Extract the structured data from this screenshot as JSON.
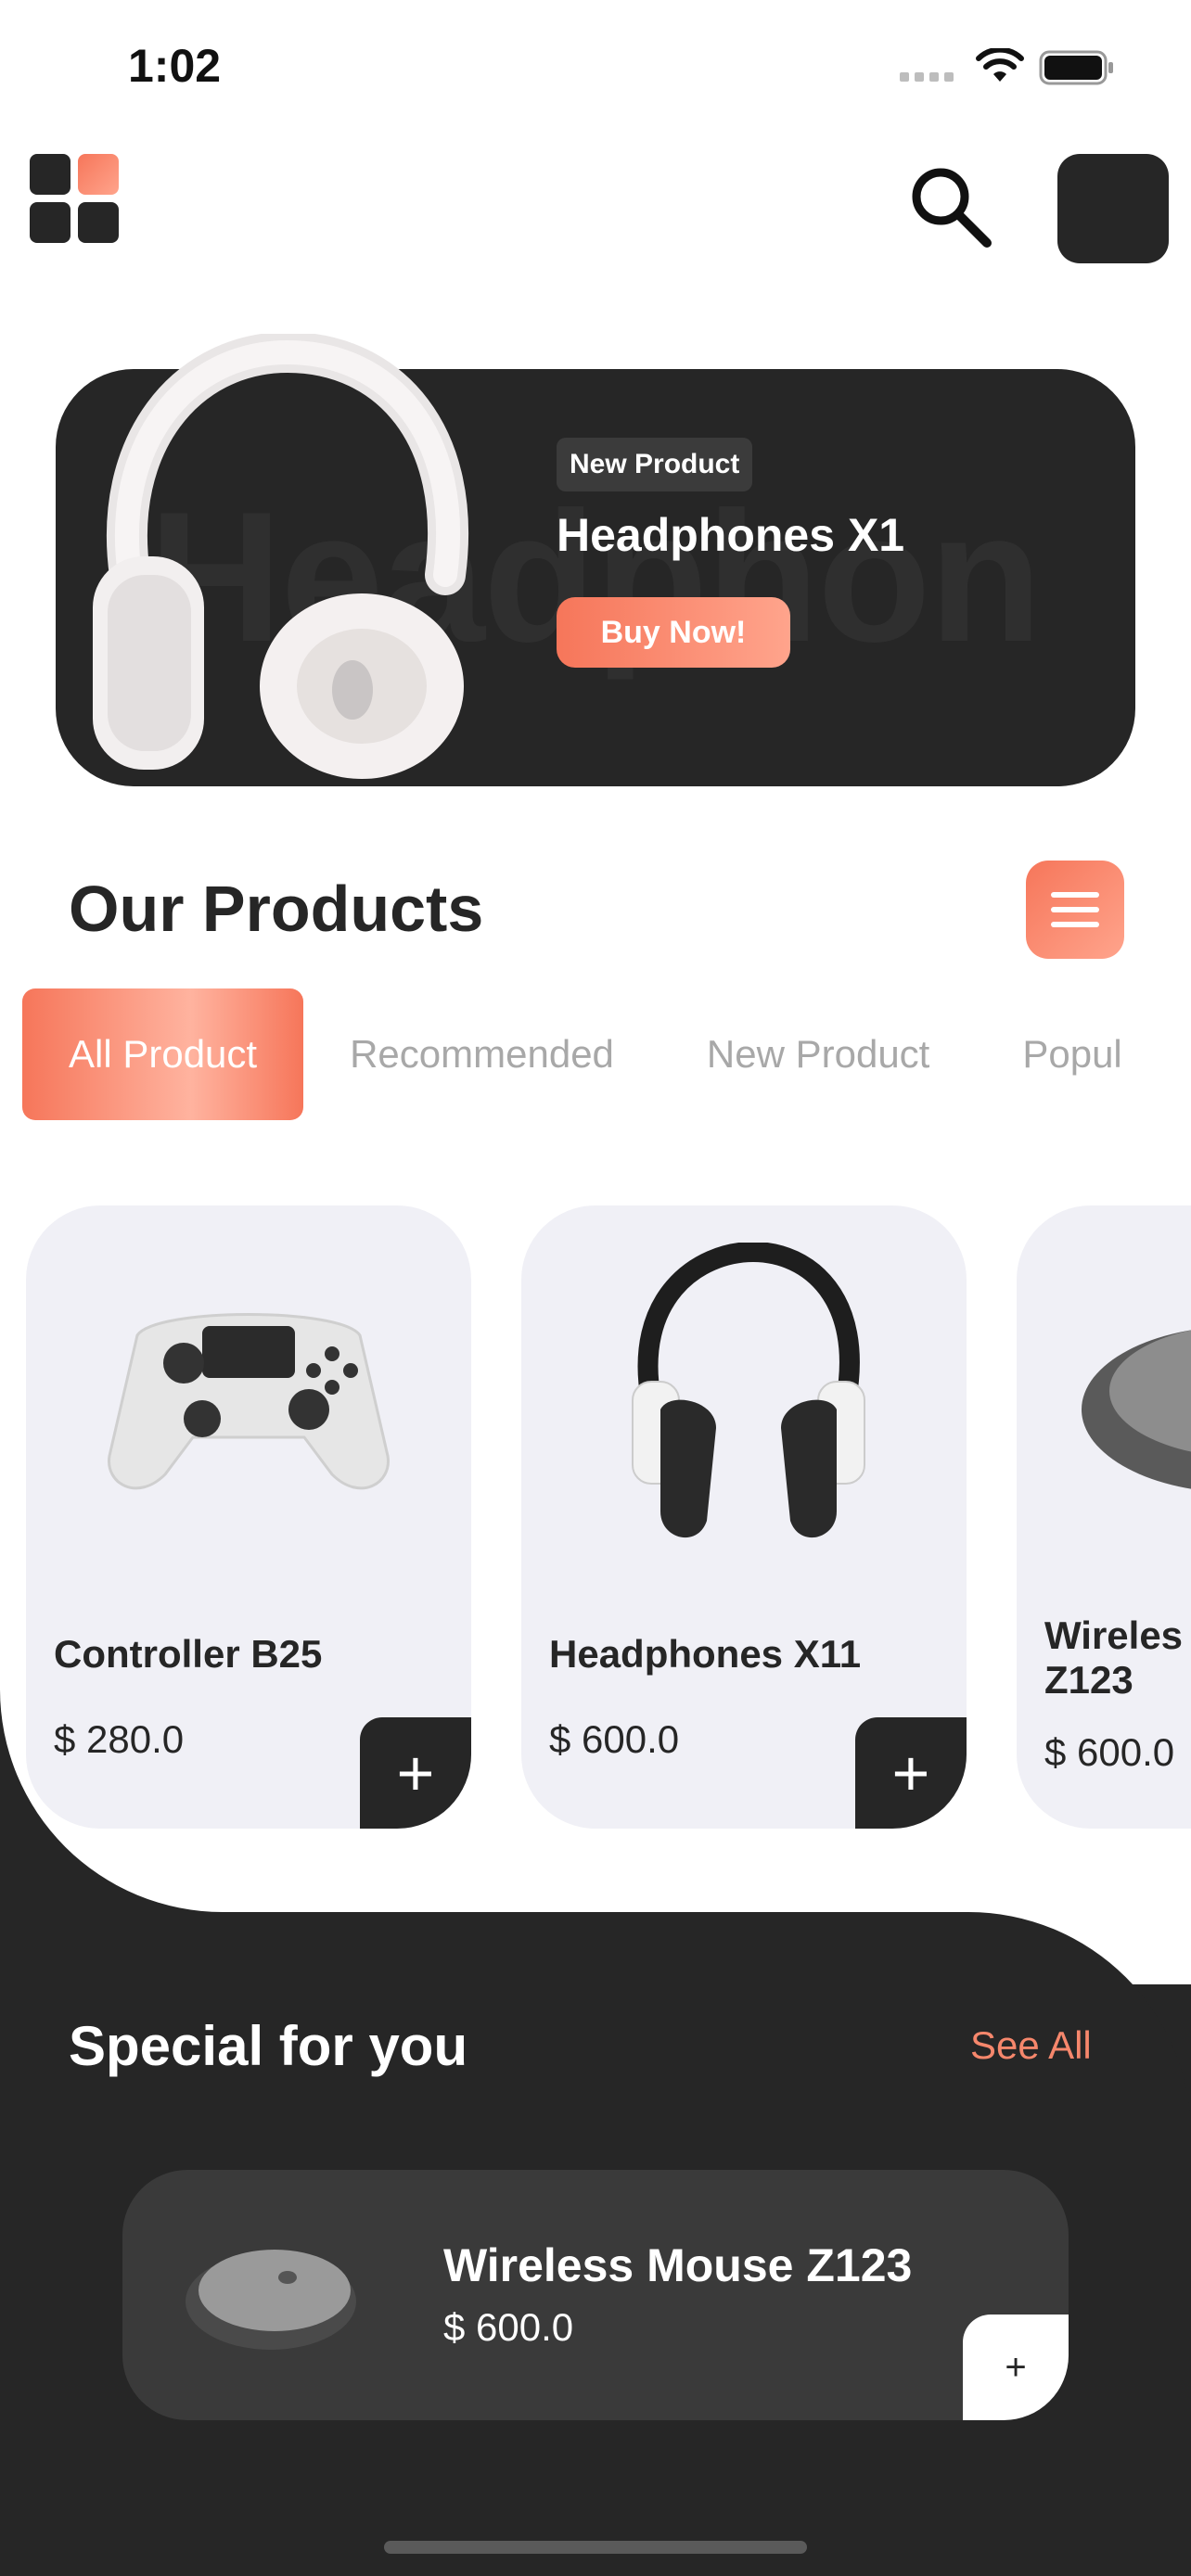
{
  "status_bar": {
    "time": "1:02"
  },
  "header": {
    "menu_icon": "grid-menu-icon",
    "search_icon": "search-icon",
    "accent_color": "#F6765A"
  },
  "banner": {
    "watermark": "Headphon",
    "badge": "New Product",
    "title": "Headphones X1",
    "cta": "Buy Now!"
  },
  "products_section": {
    "title": "Our Products",
    "tabs": [
      {
        "label": "All Product",
        "active": true
      },
      {
        "label": "Recommended",
        "active": false
      },
      {
        "label": "New Product",
        "active": false
      },
      {
        "label": "Popul",
        "active": false
      }
    ],
    "cards": [
      {
        "name": "Controller B25",
        "price": "$ 280.0",
        "add": "+"
      },
      {
        "name": "Headphones X11",
        "price": "$ 600.0",
        "add": "+"
      },
      {
        "name": "Wireles\nZ123",
        "price": "$ 600.0",
        "add": "+"
      }
    ]
  },
  "special": {
    "title": "Special for you",
    "see_all": "See All",
    "item": {
      "name": "Wireless Mouse Z123",
      "price": "$ 600.0",
      "add": "+"
    }
  }
}
